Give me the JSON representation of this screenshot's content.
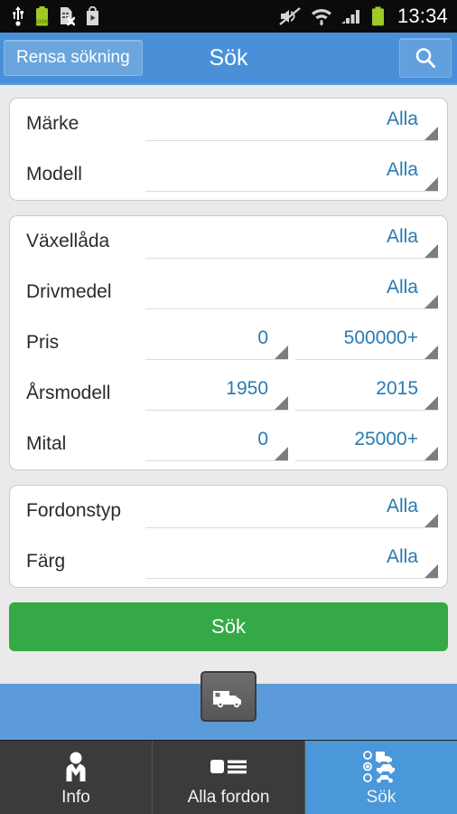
{
  "statusbar": {
    "time": "13:34",
    "left_icons": [
      "usb-icon",
      "battery-charging-icon",
      "sim-card-error-icon",
      "play-store-icon"
    ],
    "right_icons": [
      "mute-icon",
      "wifi-icon",
      "cellular-signal-icon",
      "battery-icon"
    ],
    "battery_label": "100%"
  },
  "header": {
    "clear_label": "Rensa sökning",
    "title": "Sök",
    "search_icon": "search-icon"
  },
  "cards": [
    {
      "rows": [
        {
          "label": "Märke",
          "fields": [
            {
              "value": "Alla"
            }
          ]
        },
        {
          "label": "Modell",
          "fields": [
            {
              "value": "Alla"
            }
          ]
        }
      ]
    },
    {
      "rows": [
        {
          "label": "Växellåda",
          "fields": [
            {
              "value": "Alla"
            }
          ]
        },
        {
          "label": "Drivmedel",
          "fields": [
            {
              "value": "Alla"
            }
          ]
        },
        {
          "label": "Pris",
          "fields": [
            {
              "value": "0"
            },
            {
              "value": "500000+"
            }
          ]
        },
        {
          "label": "Årsmodell",
          "fields": [
            {
              "value": "1950"
            },
            {
              "value": "2015"
            }
          ]
        },
        {
          "label": "Mital",
          "fields": [
            {
              "value": "0"
            },
            {
              "value": "25000+"
            }
          ]
        }
      ]
    },
    {
      "rows": [
        {
          "label": "Fordonstyp",
          "fields": [
            {
              "value": "Alla"
            }
          ]
        },
        {
          "label": "Färg",
          "fields": [
            {
              "value": "Alla"
            }
          ]
        }
      ]
    }
  ],
  "search_button": {
    "label": "Sök"
  },
  "camper_button": {
    "icon": "camper-van-icon"
  },
  "tabs": [
    {
      "label": "Info",
      "icon": "person-tie-icon",
      "active": false
    },
    {
      "label": "Alla fordon",
      "icon": "list-view-icon",
      "active": false
    },
    {
      "label": "Sök",
      "icon": "vehicle-select-icon",
      "active": true
    }
  ],
  "colors": {
    "header_blue": "#4a90d9",
    "accent_value_blue": "#2a7ab0",
    "search_green": "#35a945",
    "tab_active_blue": "#4a97d9",
    "tab_inactive": "#3b3b3b"
  }
}
